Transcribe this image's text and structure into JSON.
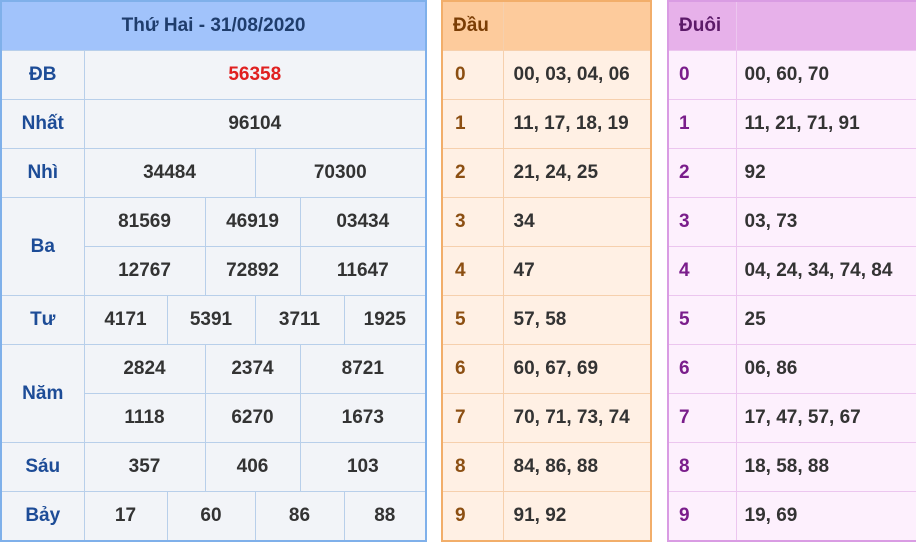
{
  "results": {
    "title": "Thứ Hai - 31/08/2020",
    "rows": [
      {
        "label": "ĐB",
        "nums": [
          "56358"
        ]
      },
      {
        "label": "Nhất",
        "nums": [
          "96104"
        ]
      },
      {
        "label": "Nhì",
        "nums": [
          "34484",
          "70300"
        ]
      },
      {
        "label": "Ba",
        "nums": [
          "81569",
          "46919",
          "03434",
          "12767",
          "72892",
          "11647"
        ]
      },
      {
        "label": "Tư",
        "nums": [
          "4171",
          "5391",
          "3711",
          "1925"
        ]
      },
      {
        "label": "Năm",
        "nums": [
          "2824",
          "2374",
          "8721",
          "1118",
          "6270",
          "1673"
        ]
      },
      {
        "label": "Sáu",
        "nums": [
          "357",
          "406",
          "103"
        ]
      },
      {
        "label": "Bảy",
        "nums": [
          "17",
          "60",
          "86",
          "88"
        ]
      }
    ]
  },
  "dau": {
    "header": "Đầu",
    "rows": [
      {
        "digit": "0",
        "values": "00, 03, 04, 06"
      },
      {
        "digit": "1",
        "values": "11, 17, 18, 19"
      },
      {
        "digit": "2",
        "values": "21, 24, 25"
      },
      {
        "digit": "3",
        "values": "34"
      },
      {
        "digit": "4",
        "values": "47"
      },
      {
        "digit": "5",
        "values": "57, 58"
      },
      {
        "digit": "6",
        "values": "60, 67, 69"
      },
      {
        "digit": "7",
        "values": "70, 71, 73, 74"
      },
      {
        "digit": "8",
        "values": "84, 86, 88"
      },
      {
        "digit": "9",
        "values": "91, 92"
      }
    ]
  },
  "duoi": {
    "header": "Đuôi",
    "rows": [
      {
        "digit": "0",
        "values": "00, 60, 70"
      },
      {
        "digit": "1",
        "values": "11, 21, 71, 91"
      },
      {
        "digit": "2",
        "values": "92"
      },
      {
        "digit": "3",
        "values": "03, 73"
      },
      {
        "digit": "4",
        "values": "04, 24, 34, 74, 84"
      },
      {
        "digit": "5",
        "values": "25"
      },
      {
        "digit": "6",
        "values": "06, 86"
      },
      {
        "digit": "7",
        "values": "17, 47, 57, 67"
      },
      {
        "digit": "8",
        "values": "18, 58, 88"
      },
      {
        "digit": "9",
        "values": "19, 69"
      }
    ]
  },
  "colors": {
    "results_header": "#a1c3fb",
    "special_prize": "#e02020",
    "dau_header": "#fdcb9c",
    "duoi_header": "#e7b1ea"
  }
}
